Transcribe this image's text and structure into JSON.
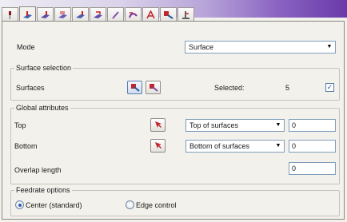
{
  "mode": {
    "label": "Mode",
    "value": "Surface"
  },
  "surface_selection": {
    "title": "Surface selection",
    "surfaces_label": "Surfaces",
    "selected_label": "Selected:",
    "selected_count": "5",
    "checkbox_mark": "✓"
  },
  "global_attributes": {
    "title": "Global attributes",
    "top_label": "Top",
    "top_option": "Top of surfaces",
    "top_value": "0",
    "bottom_label": "Bottom",
    "bottom_option": "Bottom of surfaces",
    "bottom_value": "0",
    "overlap_label": "Overlap length",
    "overlap_value": "0"
  },
  "feedrate_options": {
    "title": "Feedrate options",
    "option_center": "Center (standard)",
    "option_edge": "Edge control",
    "selected": "Center (standard)"
  },
  "tabs": [
    {
      "icon": "pin-icon"
    },
    {
      "icon": "surface-tool-icon"
    },
    {
      "icon": "surface-tool-alt-icon"
    },
    {
      "icon": "surface-grid-icon"
    },
    {
      "icon": "surface-flat-icon"
    },
    {
      "icon": "surface-step-icon"
    },
    {
      "icon": "pen-icon"
    },
    {
      "icon": "curve-tool-icon"
    },
    {
      "icon": "letter-a-icon"
    },
    {
      "icon": "parameters-icon"
    },
    {
      "icon": "toolpath-icon"
    }
  ],
  "colors": {
    "accent": "#6a3aa8",
    "tool_red": "#c0262b",
    "tool_blue": "#2a56a0"
  }
}
